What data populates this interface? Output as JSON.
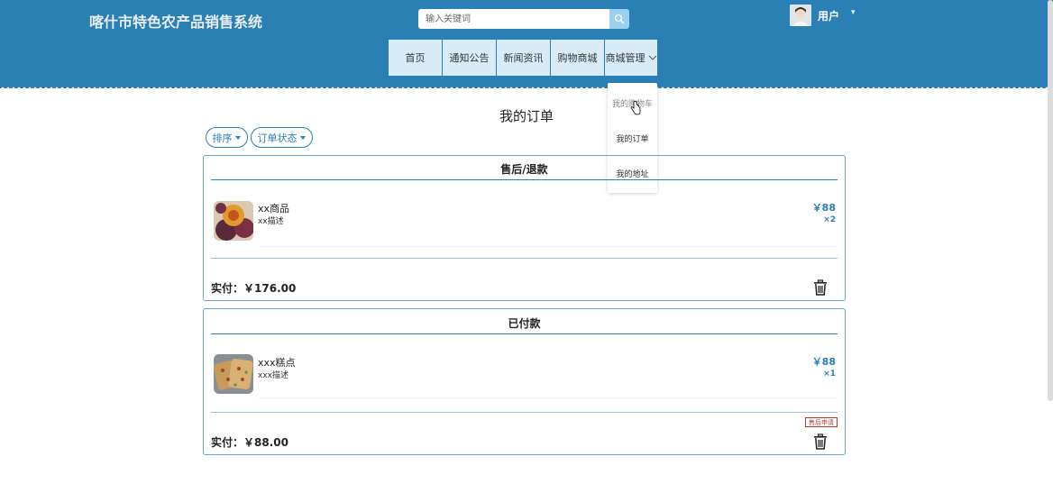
{
  "header": {
    "site_title": "喀什市特色农产品销售系统",
    "search_placeholder": "输入关键词",
    "user_label": "用户",
    "user_caret": "▾"
  },
  "nav": {
    "items": [
      "首页",
      "通知公告",
      "新闻资讯",
      "购物商城",
      "商城管理"
    ]
  },
  "dropdown": {
    "items": [
      "我的购物车",
      "我的订单",
      "我的地址"
    ]
  },
  "page": {
    "title": "我的订单",
    "filters": [
      {
        "label": "排序"
      },
      {
        "label": "订单状态"
      }
    ]
  },
  "orders": [
    {
      "status": "售后/退款",
      "product_name": "xx商品",
      "product_desc": "xx描述",
      "price": "￥88",
      "qty": "×2",
      "paid_label": "实付：",
      "paid_amount": "￥176.00"
    },
    {
      "status": "已付款",
      "product_name": "xxx糕点",
      "product_desc": "xxx描述",
      "price": "￥88",
      "qty": "×1",
      "paid_label": "实付：",
      "paid_amount": "￥88.00",
      "action_tag": "售后申请"
    }
  ],
  "colors": {
    "header_bg": "#2a7fb5",
    "nav_bg": "#d8ecf8",
    "accent": "#2a7fb5",
    "tag_red": "#c0392b"
  }
}
